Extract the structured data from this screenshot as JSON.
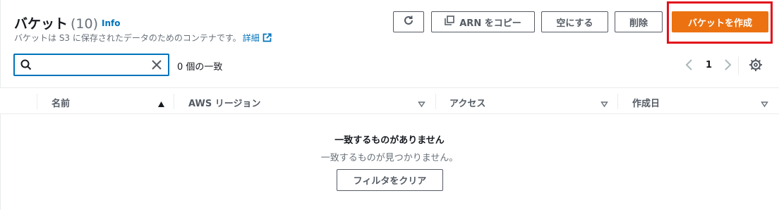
{
  "header": {
    "title": "バケット",
    "count": "(10)",
    "info": "Info",
    "description": "バケットは S3 に保存されたデータのためのコンテナです。",
    "details_link": "詳細"
  },
  "toolbar": {
    "refresh_icon": "refresh-icon",
    "copy_arn_label": "ARN をコピー",
    "empty_label": "空にする",
    "delete_label": "削除",
    "create_label": "バケットを作成"
  },
  "search": {
    "value": "",
    "placeholder": "",
    "match_count": "0 個の一致"
  },
  "pagination": {
    "current_page": "1"
  },
  "table": {
    "columns": [
      {
        "label": "名前",
        "sort": "ascending"
      },
      {
        "label": "AWS リージョン",
        "sort": "none"
      },
      {
        "label": "アクセス",
        "sort": "none"
      },
      {
        "label": "作成日",
        "sort": "none"
      }
    ]
  },
  "empty_state": {
    "title": "一致するものがありません",
    "description": "一致するものが見つかりません。",
    "clear_filter_label": "フィルタをクリア"
  },
  "colors": {
    "primary": "#ec7211",
    "link": "#0073bb",
    "highlight": "#e3101b"
  }
}
